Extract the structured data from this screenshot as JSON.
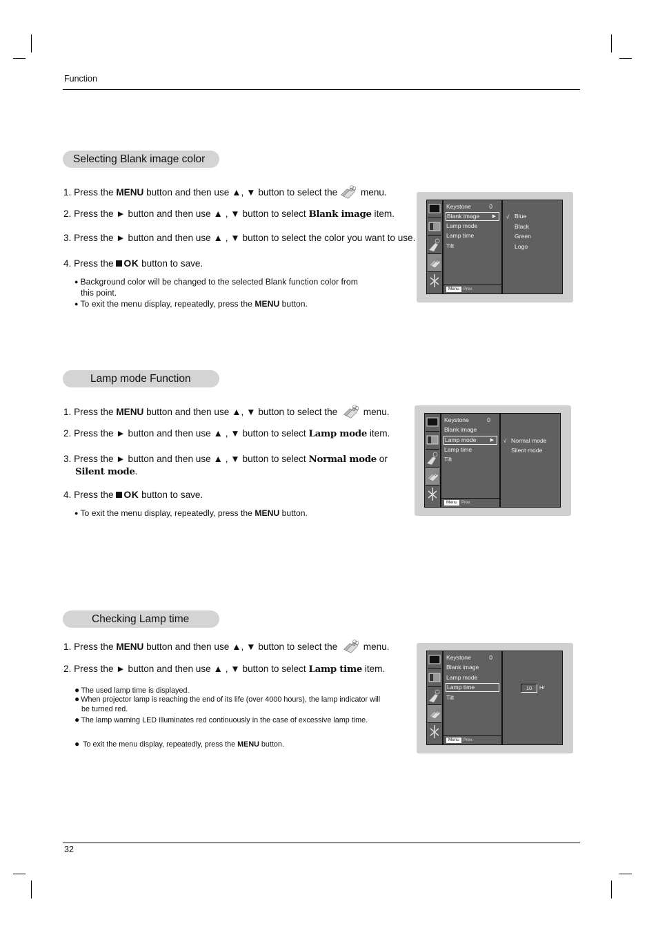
{
  "header": {
    "running_title": "Function",
    "page_number": "32"
  },
  "sections": [
    {
      "title": "Selecting Blank image color",
      "steps": {
        "s1": {
          "a": "1. Press the ",
          "menu": "MENU",
          "b": " button and then use  ▲, ▼ button to select the",
          "c": " menu."
        },
        "s2": {
          "a": "2. Press the ► button and then use ▲ , ▼ button to select ",
          "bold": "Blank image",
          "c": " item."
        },
        "s3": {
          "a": "3. Press the ► button and then use ▲ , ▼ button to select the color you want to use."
        },
        "s4": {
          "a": "4. Press the ",
          "ok": "OK",
          "c": " button to save."
        }
      },
      "notes": {
        "n1": "Background color will be changed to the selected Blank function color from",
        "n1b": "this point.",
        "n2a": "To exit the menu display, repeatedly, press the ",
        "n2menu": "MENU",
        "n2b": " button."
      },
      "osd": {
        "items": [
          "Keystone",
          "Blank image",
          "Lamp mode",
          "Lamp time",
          "Tilt"
        ],
        "keystone_value": "0",
        "selected_item": "Blank image",
        "options": [
          "Blue",
          "Black",
          "Green",
          "Logo"
        ],
        "checked_option": "Blue",
        "menu_label": "Menu",
        "prev_label": "Prev."
      }
    },
    {
      "title": "Lamp mode Function",
      "steps": {
        "s1": {
          "a": "1. Press the ",
          "menu": "MENU",
          "b": " button and then use ▲, ▼ button to select the ",
          "c": " menu."
        },
        "s2": {
          "a": "2. Press the ► button and then use ▲ , ▼ button to select ",
          "bold": "Lamp mode",
          "c": " item."
        },
        "s3": {
          "a": "3. Press the ► button and then use ▲ , ▼ button to select ",
          "bold": "Normal mode",
          "c": " or",
          "bold2": "Silent mode",
          "d": "."
        },
        "s4": {
          "a": "4. Press the ",
          "ok": "OK",
          "c": " button to save."
        }
      },
      "notes": {
        "n1a": "To exit the menu display, repeatedly, press the ",
        "n1menu": "MENU",
        "n1b": " button."
      },
      "osd": {
        "items": [
          "Keystone",
          "Blank image",
          "Lamp mode",
          "Lamp time",
          "Tilt"
        ],
        "keystone_value": "0",
        "selected_item": "Lamp mode",
        "options": [
          "Normal mode",
          "Silent mode"
        ],
        "checked_option": "Normal mode",
        "menu_label": "Menu",
        "prev_label": "Prev."
      }
    },
    {
      "title": "Checking Lamp time",
      "steps": {
        "s1": {
          "a": "1. Press the ",
          "menu": "MENU",
          "b": " button and then use ▲, ▼ button to select the ",
          "c": " menu."
        },
        "s2": {
          "a": "2. Press the ► button and then use ▲ , ▼ button to select ",
          "bold": "Lamp time",
          "c": " item."
        }
      },
      "notes": {
        "n1": "The used lamp time is displayed.",
        "n2": "When projector lamp is reaching the end of its life (over 4000 hours), the lamp indicator will",
        "n2b": "be turned red.",
        "n3": "The lamp warning LED illuminates red continuously in the case of excessive lamp time.",
        "n4a": "To exit the menu display, repeatedly, press the ",
        "n4menu": "MENU",
        "n4b": " button."
      },
      "osd": {
        "items": [
          "Keystone",
          "Blank image",
          "Lamp mode",
          "Lamp time",
          "Tilt"
        ],
        "keystone_value": "0",
        "selected_item": "Lamp time",
        "lamp_hours": "10",
        "lamp_unit": "Hr",
        "menu_label": "Menu",
        "prev_label": "Prev."
      }
    }
  ],
  "icons": [
    "picture-icon",
    "screen-icon",
    "tag-icon",
    "double-tag-icon",
    "scissors-icon"
  ]
}
